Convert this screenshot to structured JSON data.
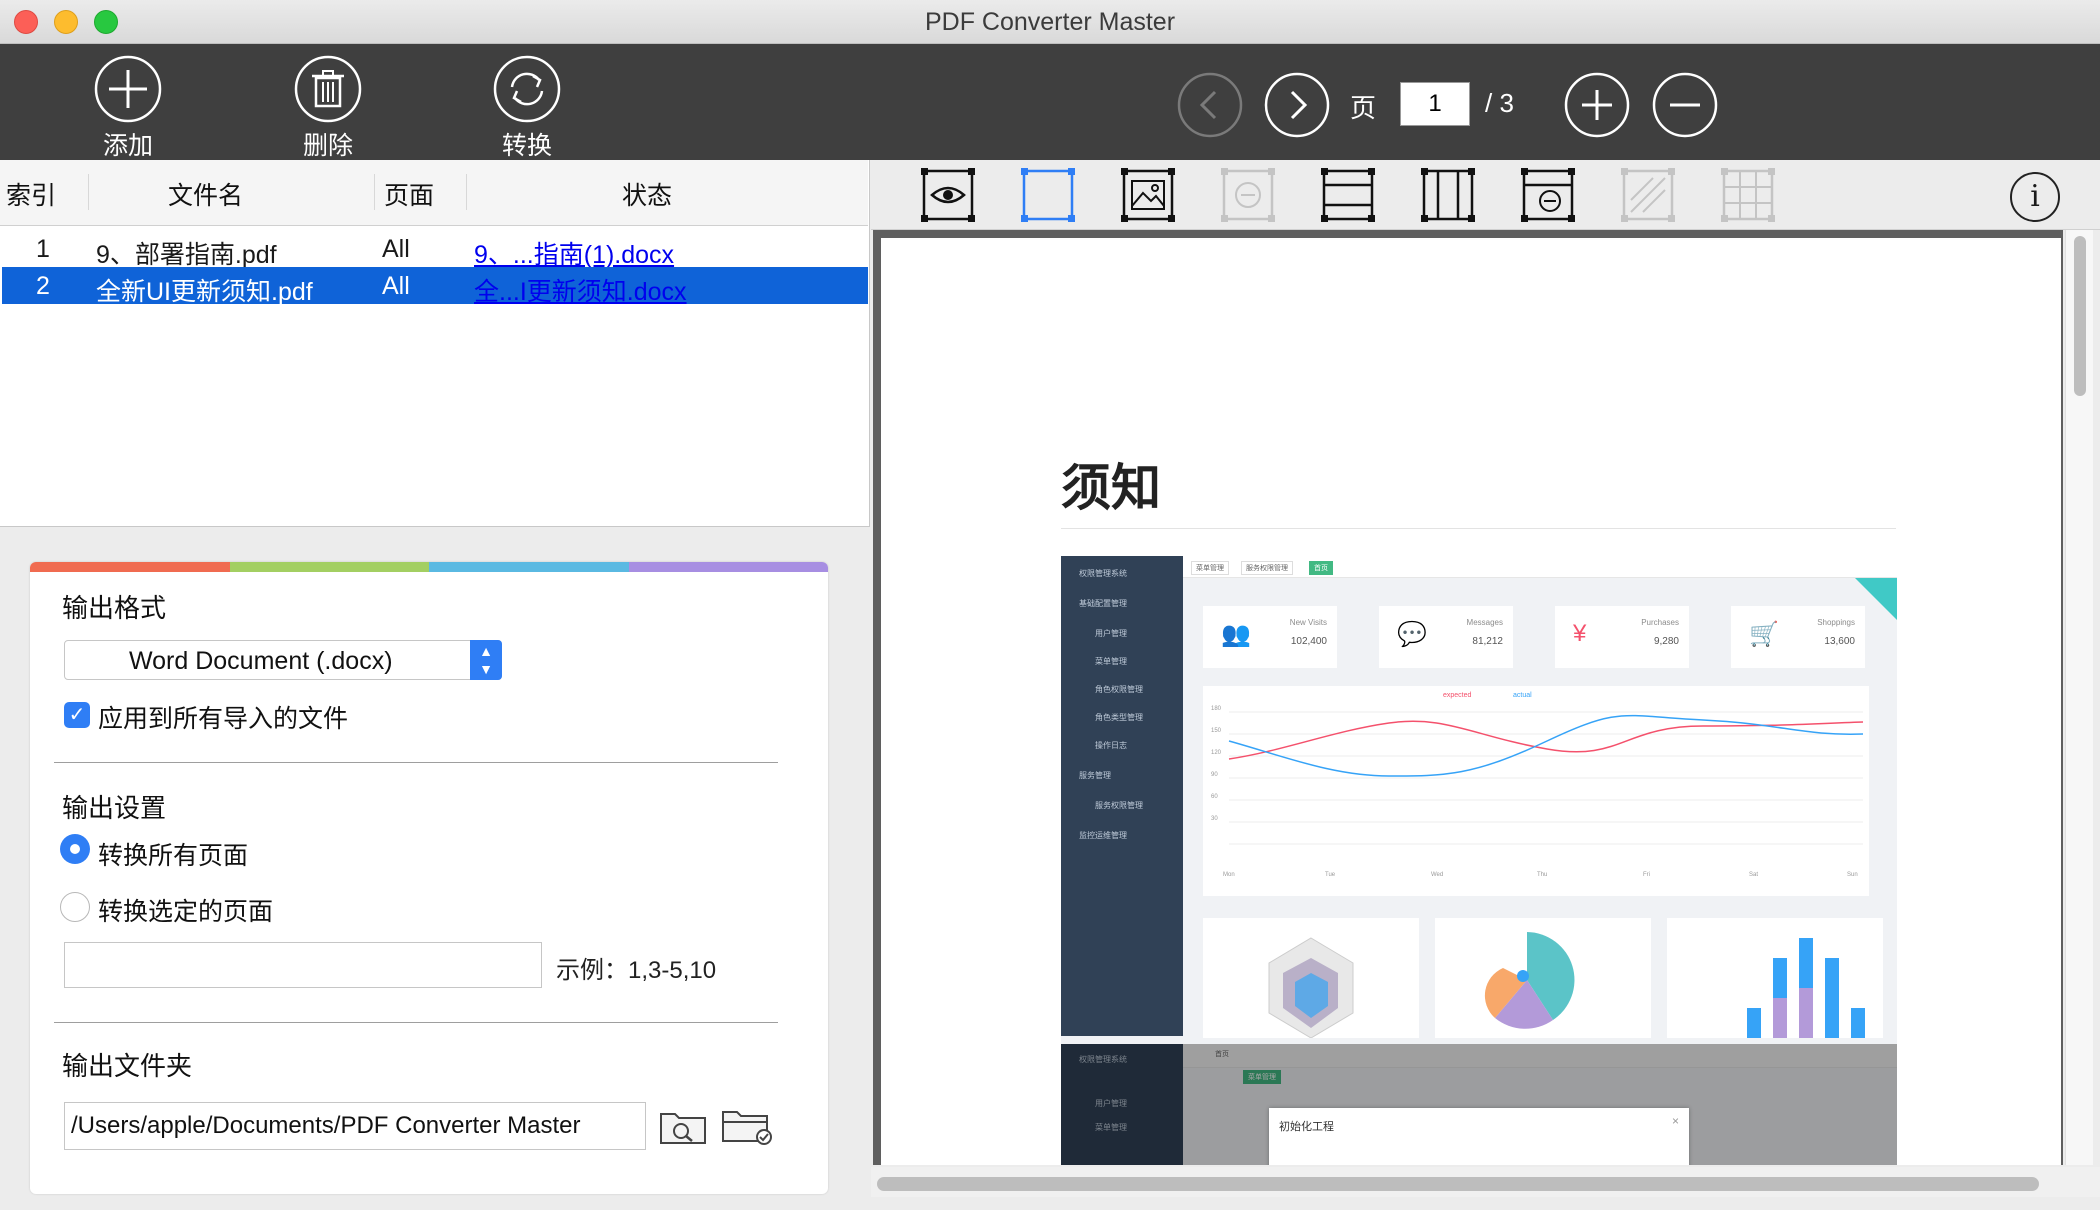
{
  "window": {
    "title": "PDF Converter Master"
  },
  "toolbar": {
    "add_label": "添加",
    "delete_label": "删除",
    "convert_label": "转换",
    "page_word": "页",
    "current_page": "1",
    "total_pages": "/ 3"
  },
  "file_list": {
    "headers": {
      "index": "索引",
      "name": "文件名",
      "pages": "页面",
      "status": "状态"
    },
    "rows": [
      {
        "index": "1",
        "name": "9、部署指南.pdf",
        "pages": "All",
        "status": "9、...指南(1).docx"
      },
      {
        "index": "2",
        "name": "全新UI更新须知.pdf",
        "pages": "All",
        "status": "全...I更新须知.docx"
      }
    ],
    "selected_row": 2
  },
  "settings": {
    "strip_colors": [
      "#f06b50",
      "#a3cf62",
      "#5ab9e2",
      "#a78ee2"
    ],
    "output_format_label": "输出格式",
    "output_format_value": "Word Document (.docx)",
    "apply_all_label": "应用到所有导入的文件",
    "apply_all_checked": true,
    "output_settings_label": "输出设置",
    "convert_all_label": "转换所有页面",
    "convert_selected_label": "转换选定的页面",
    "selected_pages_value": "",
    "example_text": "示例：1,3-5,10",
    "output_folder_label": "输出文件夹",
    "output_folder_value": "/Users/apple/Documents/PDF Converter Master"
  },
  "preview": {
    "tools": [
      "eye-view-icon",
      "select-rect-icon",
      "image-region-icon",
      "exclude-region-icon",
      "horizontal-split-icon",
      "vertical-split-icon",
      "remove-region-icon",
      "hatch-region-icon",
      "table-region-icon"
    ],
    "doc_heading": "须知",
    "dashboard": {
      "sidebar_items": [
        "权限管理系统",
        "基础配置管理",
        "用户管理",
        "菜单管理",
        "角色权限管理",
        "角色类型管理",
        "操作日志",
        "服务管理",
        "服务权限管理",
        "监控运维管理"
      ],
      "crumbs": [
        "菜单管理",
        "服务权限管理",
        "首页"
      ],
      "stats": [
        {
          "name": "New Visits",
          "value": "102,400",
          "icon": "👥",
          "color": "#40c9c6"
        },
        {
          "name": "Messages",
          "value": "81,212",
          "icon": "💬",
          "color": "#36a3f7"
        },
        {
          "name": "Purchases",
          "value": "9,280",
          "icon": "¥",
          "color": "#f4516c"
        },
        {
          "name": "Shoppings",
          "value": "13,600",
          "icon": "🛒",
          "color": "#34bfa3"
        }
      ],
      "legend": [
        "expected",
        "actual"
      ],
      "weekdays": [
        "Mon",
        "Tue",
        "Wed",
        "Thu",
        "Fri",
        "Sat",
        "Sun"
      ],
      "y_ticks": [
        "180",
        "150",
        "120",
        "90",
        "60",
        "30"
      ],
      "second_sidebar": [
        "权限管理系统",
        "用户管理",
        "菜单管理"
      ],
      "second_crumbs": [
        "首页",
        "菜单管理"
      ],
      "dialog_title": "初始化工程"
    }
  }
}
